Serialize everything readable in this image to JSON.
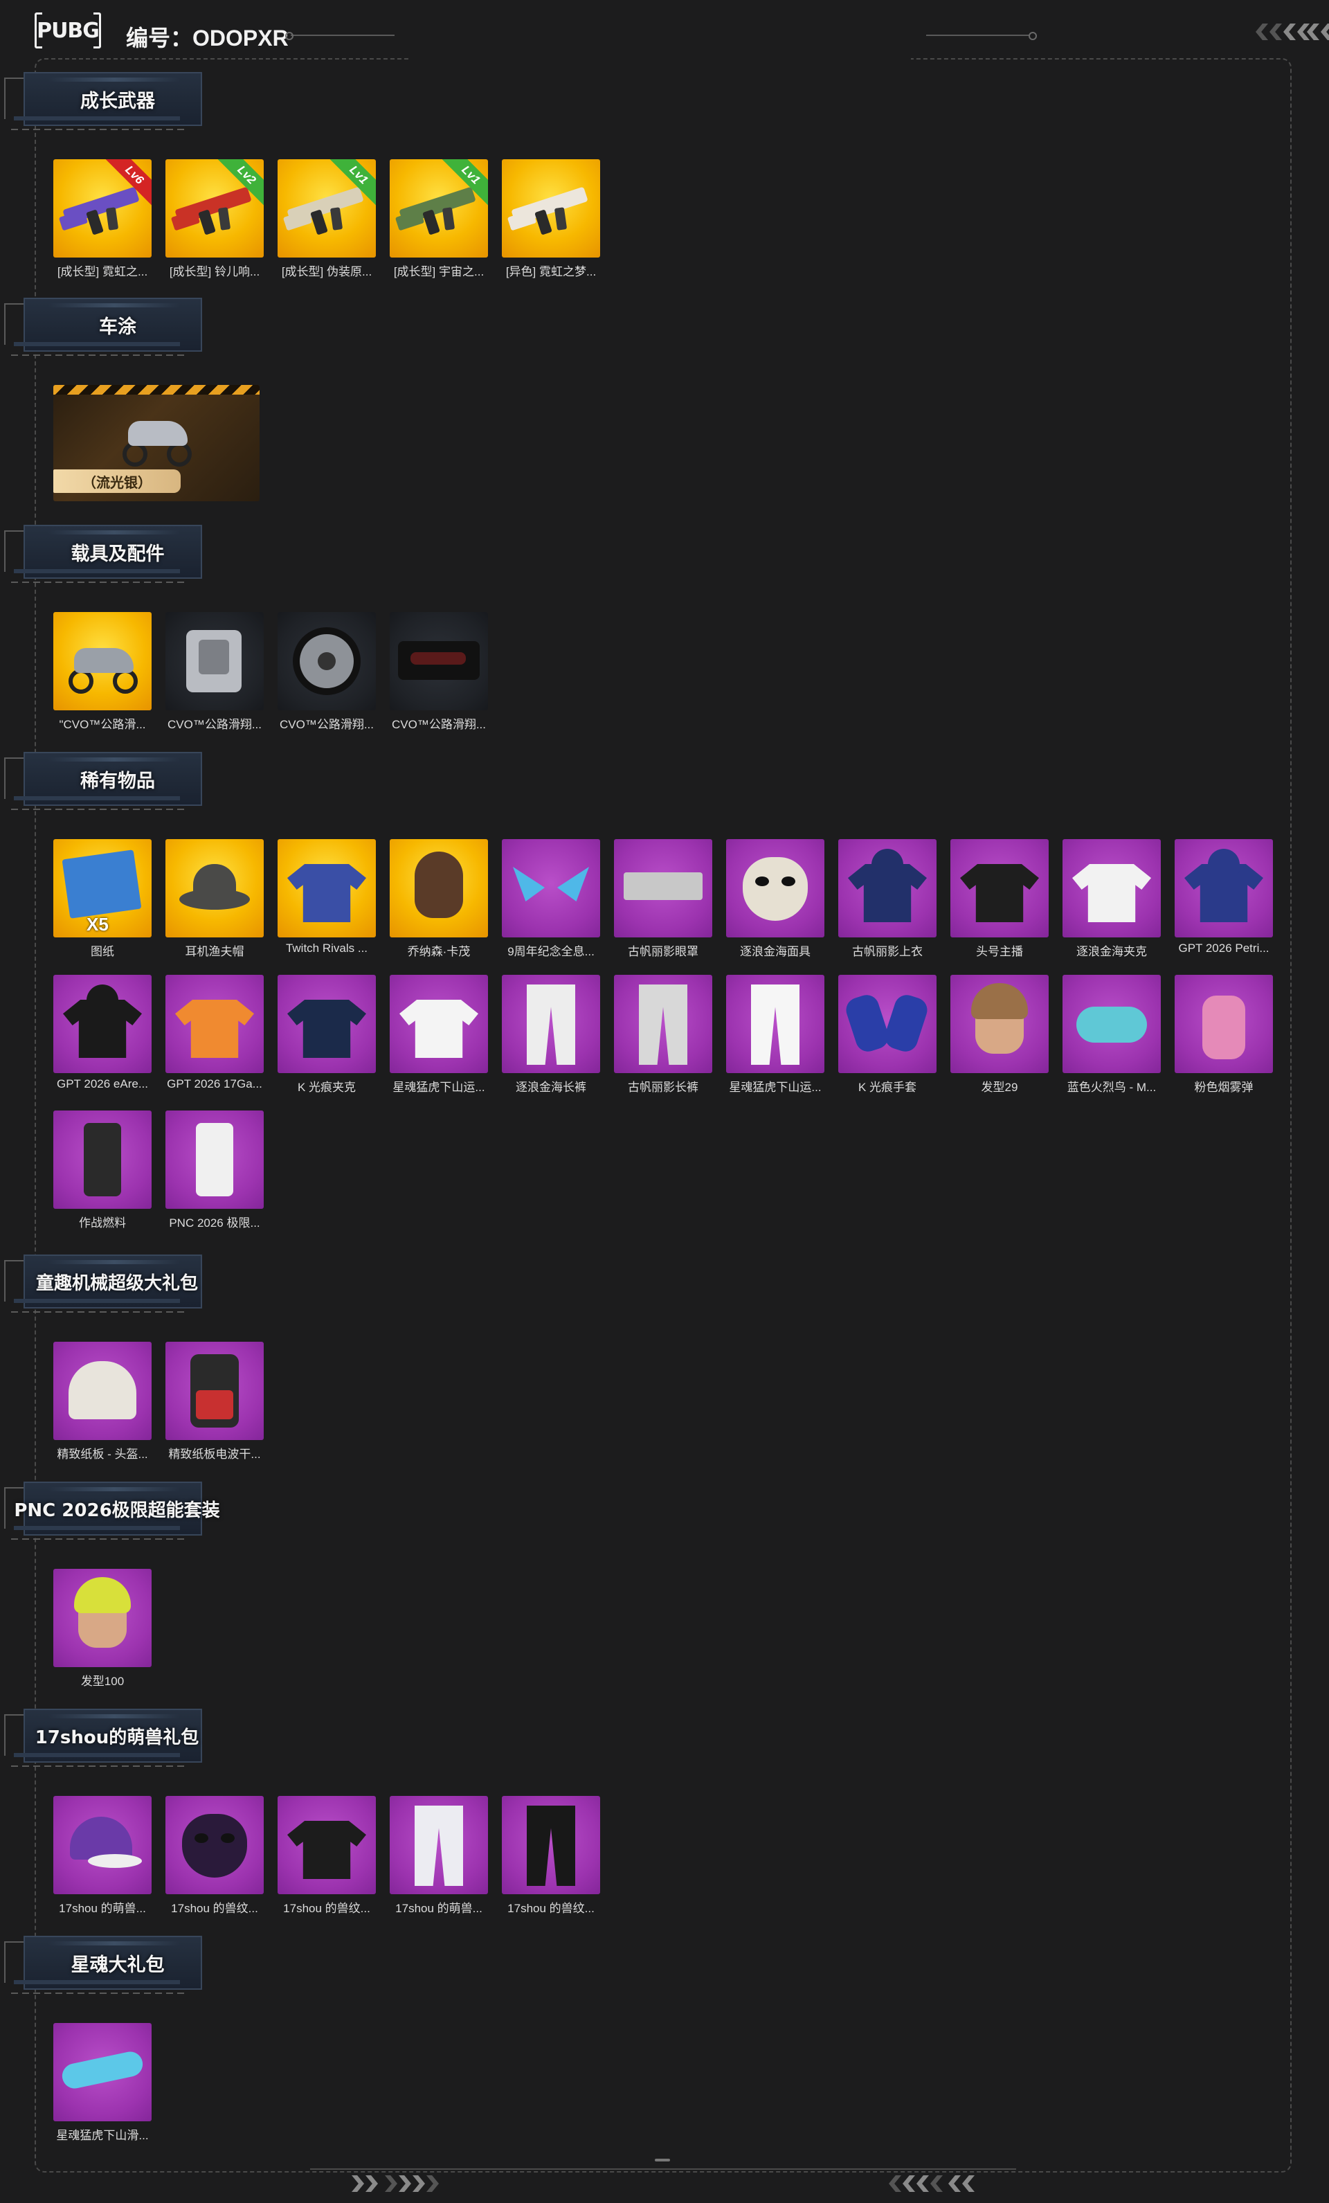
{
  "header": {
    "logo_text": "PUBG",
    "serial_label": "编号：ODOPXR"
  },
  "sections": [
    {
      "title": "成长武器",
      "items": [
        {
          "label": "[成长型] 霓虹之...",
          "bg": "yellow",
          "icon": "rifle-icon",
          "level": "Lv6",
          "ribbon_color": "#d42424",
          "art_color": "#6a4fc3"
        },
        {
          "label": "[成长型] 铃儿响...",
          "bg": "yellow",
          "icon": "rifle-icon",
          "level": "Lv2",
          "ribbon_color": "#3fb23a",
          "art_color": "#c93226"
        },
        {
          "label": "[成长型] 伪装原...",
          "bg": "yellow",
          "icon": "rifle-icon",
          "level": "Lv1",
          "ribbon_color": "#3fb23a",
          "art_color": "#d9d0b8"
        },
        {
          "label": "[成长型] 宇宙之...",
          "bg": "yellow",
          "icon": "rifle-icon",
          "level": "Lv1",
          "ribbon_color": "#3fb23a",
          "art_color": "#5e7f48"
        },
        {
          "label": "[异色] 霓虹之梦...",
          "bg": "yellow",
          "icon": "rifle-icon",
          "level": "",
          "ribbon_color": "",
          "art_color": "#ece6dc"
        }
      ]
    },
    {
      "title": "车涂",
      "items": [
        {
          "label": "（流光银）",
          "bg": "wide",
          "icon": "motorcycle-icon",
          "art_color": "#b8bcc4"
        }
      ]
    },
    {
      "title": "载具及配件",
      "items": [
        {
          "label": "\"CVO™公路滑...",
          "bg": "yellow",
          "icon": "motorcycle-icon",
          "art_color": "#9aa0a8"
        },
        {
          "label": "CVO™公路滑翔...",
          "bg": "dark",
          "icon": "engine-icon",
          "art_color": "#b9bcc2"
        },
        {
          "label": "CVO™公路滑翔...",
          "bg": "dark",
          "icon": "wheel-icon",
          "art_color": "#8e9298"
        },
        {
          "label": "CVO™公路滑翔...",
          "bg": "dark",
          "icon": "exhaust-icon",
          "art_color": "#5a1a1a"
        }
      ]
    },
    {
      "title": "稀有物品",
      "items": [
        {
          "label": "图纸",
          "bg": "yellow",
          "icon": "blueprint-icon",
          "qty": "X5",
          "art_color": "#3a7fd1"
        },
        {
          "label": "耳机渔夫帽",
          "bg": "yellow",
          "icon": "bucket-hat-icon",
          "art_color": "#4a4a48"
        },
        {
          "label": "Twitch Rivals ...",
          "bg": "yellow",
          "icon": "jacket-icon",
          "art_color": "#3a4fa6"
        },
        {
          "label": "乔纳森·卡茂",
          "bg": "yellow",
          "icon": "face-icon",
          "art_color": "#5a3b28"
        },
        {
          "label": "9周年纪念全息...",
          "bg": "purple",
          "icon": "cat-ears-icon",
          "art_color": "#4fb8e8"
        },
        {
          "label": "古帆丽影眼罩",
          "bg": "purple",
          "icon": "eye-mask-icon",
          "art_color": "#c8c8c8"
        },
        {
          "label": "逐浪金海面具",
          "bg": "purple",
          "icon": "skull-mask-icon",
          "art_color": "#e6e0d2"
        },
        {
          "label": "古帆丽影上衣",
          "bg": "purple",
          "icon": "hoodie-icon",
          "art_color": "#22306a"
        },
        {
          "label": "头号主播",
          "bg": "purple",
          "icon": "tshirt-icon",
          "art_color": "#1e1e1e"
        },
        {
          "label": "逐浪金海夹克",
          "bg": "purple",
          "icon": "jacket-icon",
          "art_color": "#f2f2f2"
        },
        {
          "label": "GPT 2026 Petri...",
          "bg": "purple",
          "icon": "hoodie-icon",
          "art_color": "#2a3a8a"
        },
        {
          "label": "GPT 2026 eAre...",
          "bg": "purple",
          "icon": "hoodie-icon",
          "art_color": "#1a1a1a"
        },
        {
          "label": "GPT 2026 17Ga...",
          "bg": "purple",
          "icon": "jacket-icon",
          "art_color": "#f08a30"
        },
        {
          "label": "K 光痕夹克",
          "bg": "purple",
          "icon": "jacket-icon",
          "art_color": "#1b2a4a"
        },
        {
          "label": "星魂猛虎下山运...",
          "bg": "purple",
          "icon": "jacket-icon",
          "art_color": "#f4f4f4"
        },
        {
          "label": "逐浪金海长裤",
          "bg": "purple",
          "icon": "pants-icon",
          "art_color": "#ededed"
        },
        {
          "label": "古帆丽影长裤",
          "bg": "purple",
          "icon": "pants-icon",
          "art_color": "#d8d8d8"
        },
        {
          "label": "星魂猛虎下山运...",
          "bg": "purple",
          "icon": "pants-icon",
          "art_color": "#f6f6f6"
        },
        {
          "label": "K 光痕手套",
          "bg": "purple",
          "icon": "gloves-icon",
          "art_color": "#2a3ea8"
        },
        {
          "label": "发型29",
          "bg": "purple",
          "icon": "hair-icon",
          "art_color": "#9a7048"
        },
        {
          "label": "蓝色火烈鸟 - M...",
          "bg": "purple",
          "icon": "mask-icon",
          "art_color": "#5fc8d6"
        },
        {
          "label": "粉色烟雾弹",
          "bg": "purple",
          "icon": "grenade-icon",
          "art_color": "#e58ab8"
        },
        {
          "label": "作战燃料",
          "bg": "purple",
          "icon": "can-icon",
          "art_color": "#2a2a2a"
        },
        {
          "label": "PNC 2026 极限...",
          "bg": "purple",
          "icon": "can-icon",
          "art_color": "#f0f0f0"
        }
      ]
    },
    {
      "title": "童趣机械超级大礼包",
      "items": [
        {
          "label": "精致纸板 - 头盔...",
          "bg": "purple",
          "icon": "helmet-icon",
          "art_color": "#e8e4dc"
        },
        {
          "label": "精致纸板电波干...",
          "bg": "purple",
          "icon": "backpack-icon",
          "art_color": "#c83030"
        }
      ]
    },
    {
      "title": "PNC 2026极限超能套装",
      "items": [
        {
          "label": "发型100",
          "bg": "purple",
          "icon": "hair-icon",
          "art_color": "#d8e03a"
        }
      ]
    },
    {
      "title": "17shou的萌兽礼包",
      "items": [
        {
          "label": "17shou 的萌兽...",
          "bg": "purple",
          "icon": "cap-icon",
          "art_color": "#6a3aa8"
        },
        {
          "label": "17shou 的兽纹...",
          "bg": "purple",
          "icon": "face-mask-icon",
          "art_color": "#2a1a3a"
        },
        {
          "label": "17shou 的兽纹...",
          "bg": "purple",
          "icon": "jacket-icon",
          "art_color": "#1c1c1c"
        },
        {
          "label": "17shou 的萌兽...",
          "bg": "purple",
          "icon": "pants-icon",
          "art_color": "#ececf2"
        },
        {
          "label": "17shou 的兽纹...",
          "bg": "purple",
          "icon": "pants-icon",
          "art_color": "#181818"
        }
      ]
    },
    {
      "title": "星魂大礼包",
      "items": [
        {
          "label": "星魂猛虎下山滑...",
          "bg": "purple",
          "icon": "goggles-icon",
          "art_color": "#5cc8e8"
        }
      ]
    }
  ]
}
